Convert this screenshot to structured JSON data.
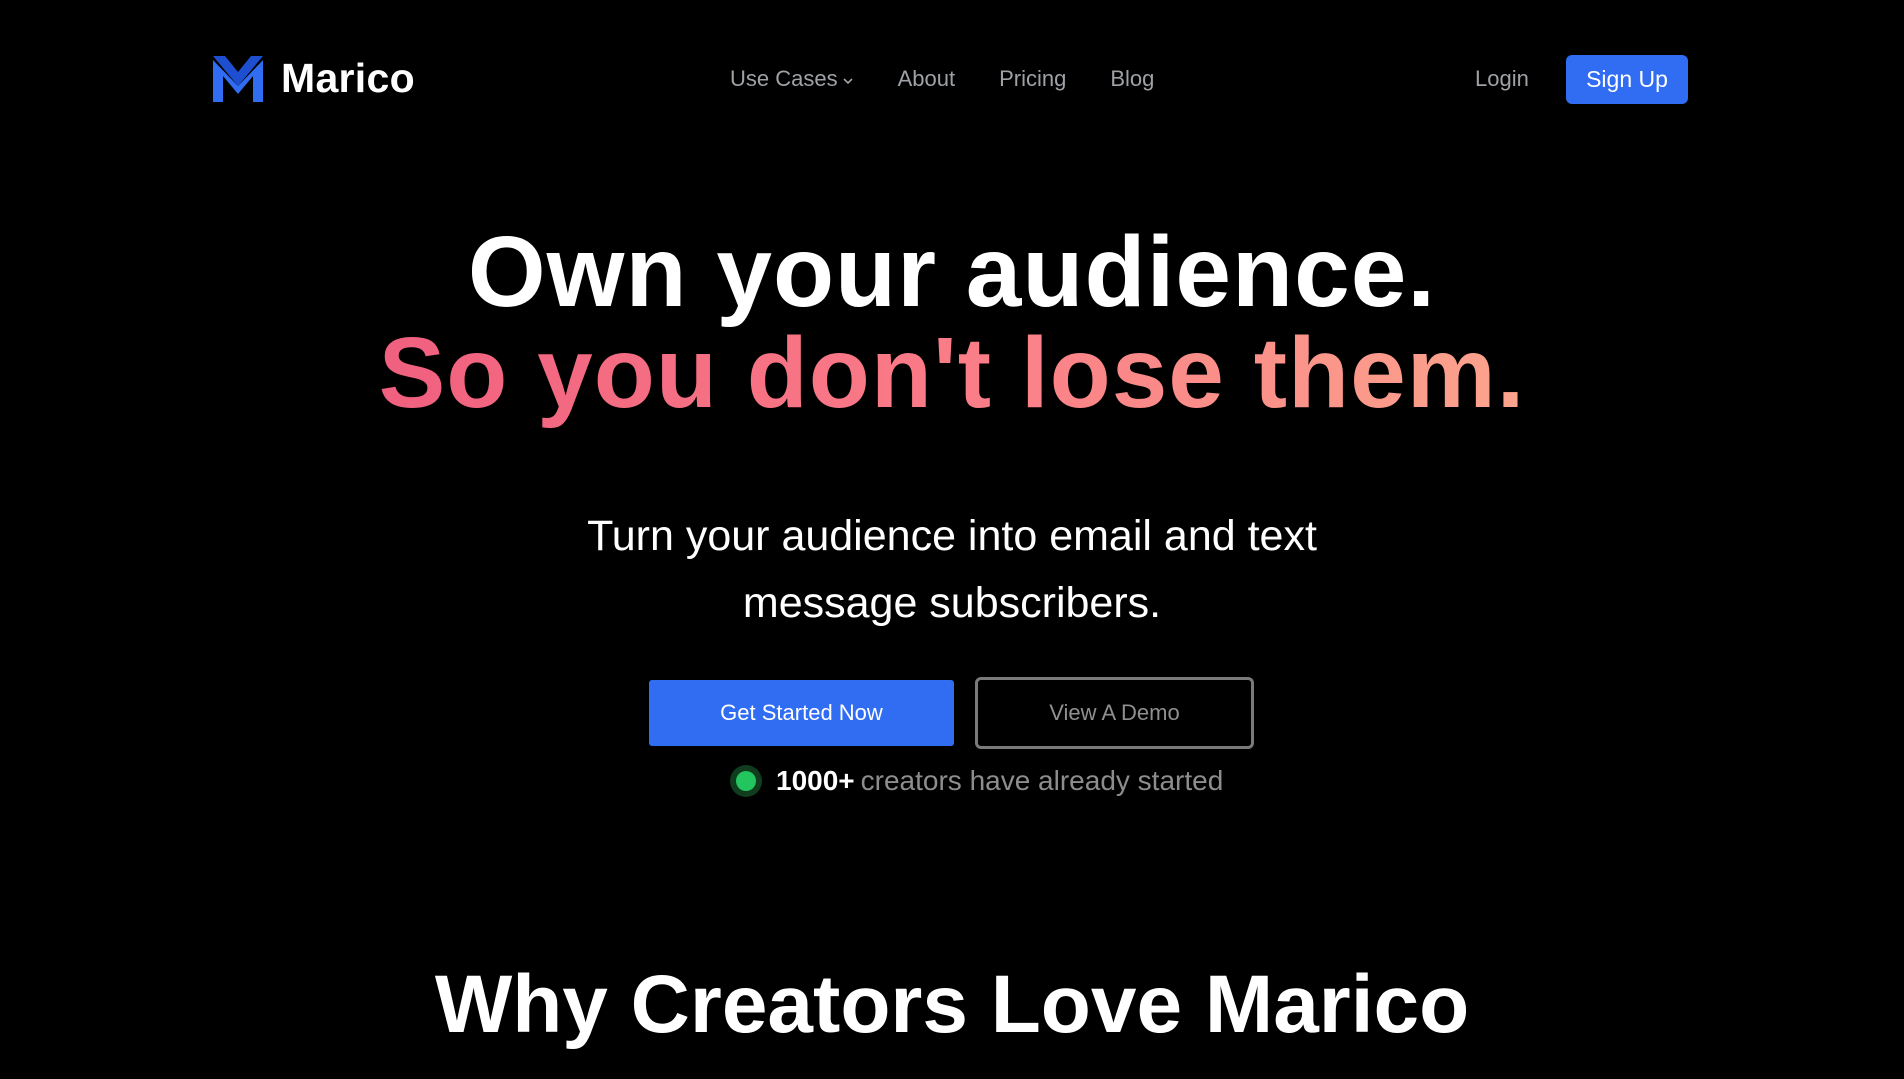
{
  "brand": {
    "name": "Marico",
    "logo_icon": "marico-m-logo-icon",
    "logo_color": "#306df2"
  },
  "nav": {
    "items": [
      {
        "label": "Use Cases",
        "has_dropdown": true,
        "icon": "chevron-down-icon"
      },
      {
        "label": "About"
      },
      {
        "label": "Pricing"
      },
      {
        "label": "Blog"
      }
    ]
  },
  "header": {
    "login_label": "Login",
    "signup_label": "Sign Up"
  },
  "hero": {
    "headline_line1": "Own your audience.",
    "headline_line2": "So you don't lose them.",
    "gradient_colors": [
      "#f0607f",
      "#fa7c87",
      "#fba48c"
    ],
    "subtitle": "Turn your audience into email and text message subscribers.",
    "primary_cta": "Get Started Now",
    "secondary_cta": "View A Demo",
    "social_proof": {
      "count": "1000+",
      "text": "creators have already started",
      "status_icon": "green-dot-icon",
      "status_color": "#22c55e"
    }
  },
  "section": {
    "title": "Why Creators Love Marico"
  },
  "colors": {
    "background": "#000000",
    "accent": "#306df2",
    "muted_text": "#9ea1a6"
  }
}
